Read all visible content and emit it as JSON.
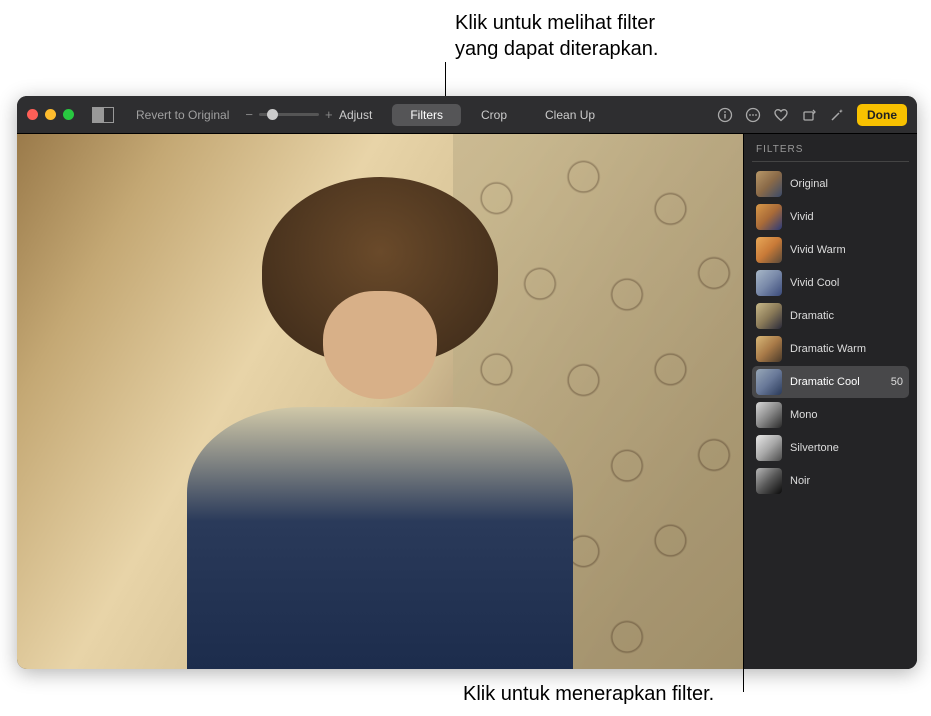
{
  "callouts": {
    "top": "Klik untuk melihat filter\nyang dapat diterapkan.",
    "bottom": "Klik untuk menerapkan filter."
  },
  "toolbar": {
    "revert_label": "Revert to Original",
    "tabs": {
      "adjust": "Adjust",
      "filters": "Filters",
      "crop": "Crop",
      "cleanup": "Clean Up"
    },
    "done_label": "Done"
  },
  "filters_panel": {
    "title": "FILTERS",
    "items": [
      {
        "label": "Original",
        "thumb": "th-original",
        "selected": false
      },
      {
        "label": "Vivid",
        "thumb": "th-vivid",
        "selected": false
      },
      {
        "label": "Vivid Warm",
        "thumb": "th-vividwarm",
        "selected": false
      },
      {
        "label": "Vivid Cool",
        "thumb": "th-vividcool",
        "selected": false
      },
      {
        "label": "Dramatic",
        "thumb": "th-dramatic",
        "selected": false
      },
      {
        "label": "Dramatic Warm",
        "thumb": "th-dramaticwarm",
        "selected": false
      },
      {
        "label": "Dramatic Cool",
        "thumb": "th-dramaticcool",
        "selected": true,
        "value": "50"
      },
      {
        "label": "Mono",
        "thumb": "th-mono",
        "selected": false
      },
      {
        "label": "Silvertone",
        "thumb": "th-silvertone",
        "selected": false
      },
      {
        "label": "Noir",
        "thumb": "th-noir",
        "selected": false
      }
    ]
  }
}
